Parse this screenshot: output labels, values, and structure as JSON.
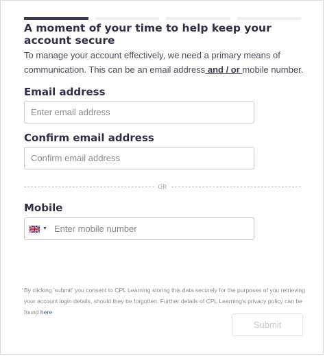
{
  "progress": {
    "steps_total": 4,
    "steps_active": 1
  },
  "title": "A moment of your time to help keep your account secure",
  "intro": {
    "part1": "To manage your account effectively, we need a primary means of communication. This can be an email address",
    "emphasis": " and / or ",
    "part2": "mobile number."
  },
  "email": {
    "label": "Email address",
    "placeholder": "Enter email address",
    "value": ""
  },
  "confirm_email": {
    "label": "Confirm email address",
    "placeholder": "Confirm email address",
    "value": ""
  },
  "divider": {
    "text": "OR"
  },
  "mobile": {
    "label": "Mobile",
    "country_icon": "uk-flag-icon",
    "placeholder": "Enter mobile number",
    "value": ""
  },
  "consent": {
    "text": "By clicking 'submit' you consent to CPL Learning storing this data securely for the purposes of you retrieving your account login details, should they be forgotten. Further details of CPL Learning's privacy policy can be found ",
    "link": "here"
  },
  "submit": {
    "label": "Submit",
    "disabled": true
  },
  "colors": {
    "accent": "#3b3b56",
    "link": "#3d5a8a",
    "disabled_text": "#c8c8c8"
  }
}
